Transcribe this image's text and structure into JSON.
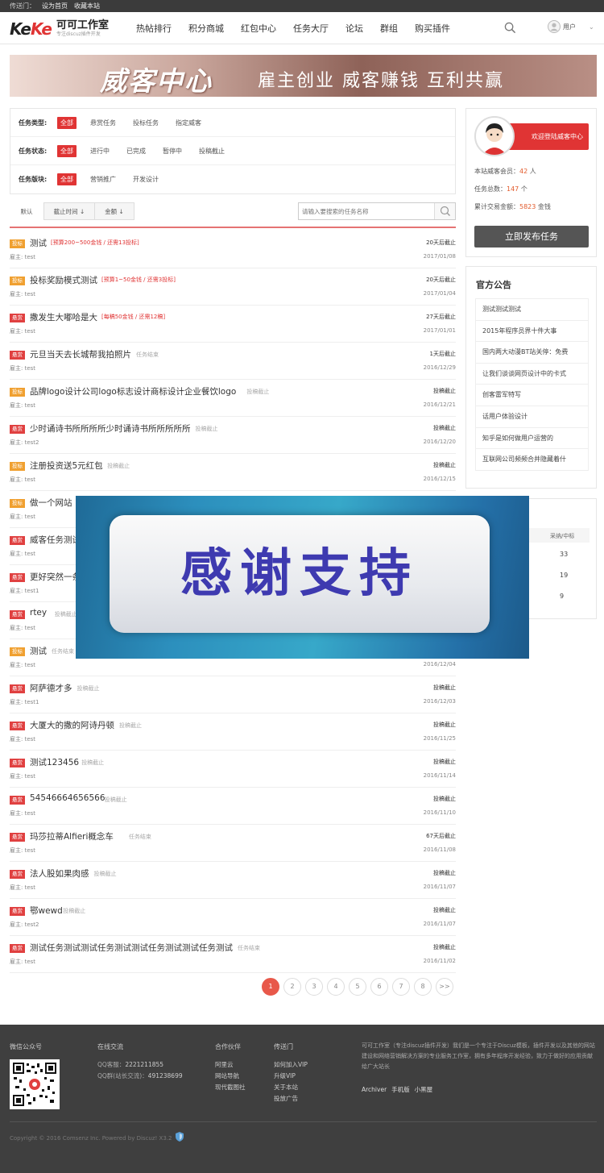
{
  "topbar": {
    "label": "传送门：",
    "set_home": "设为首页",
    "bookmark": "收藏本站"
  },
  "logo": {
    "k1": "Ke",
    "k2": "Ke",
    "name": "可可工作室",
    "slogan": "专注discuz插件开发"
  },
  "nav": [
    "热帖排行",
    "积分商城",
    "红包中心",
    "任务大厅",
    "论坛",
    "群组",
    "购买插件"
  ],
  "user": {
    "name": "用户"
  },
  "banner": {
    "title": "威客中心",
    "slogan": "雇主创业 威客赚钱 互利共赢"
  },
  "filters": [
    {
      "label": "任务类型:",
      "options": [
        "全部",
        "悬赏任务",
        "投标任务",
        "指定威客"
      ]
    },
    {
      "label": "任务状态:",
      "options": [
        "全部",
        "进行中",
        "已完成",
        "暂停中",
        "投稿截止"
      ]
    },
    {
      "label": "任务版块:",
      "options": [
        "全部",
        "营销推广",
        "开发设计"
      ]
    }
  ],
  "sort": {
    "default": "默认",
    "deadline": "截止时间",
    "amount": "金额",
    "search_placeholder": "请输入要搜索的任务名称"
  },
  "tasks": [
    {
      "tag": "投标",
      "type": "tb",
      "title": "测试",
      "budget": "[预算200~500金钱 / 还需13投标]",
      "status": "",
      "employer": "雇主: test",
      "deadline": "20天后截止",
      "date": "2017/01/08"
    },
    {
      "tag": "投标",
      "type": "tb",
      "title": "投标奖励模式测试",
      "budget": "[预算1~50金钱 / 还需3投标]",
      "status": "",
      "employer": "雇主: test",
      "deadline": "20天后截止",
      "date": "2017/01/04"
    },
    {
      "tag": "悬赏",
      "type": "xs",
      "title": "撒发生大嘟哈是大",
      "budget": "[每稿50金钱 / 还需12稿]",
      "status": "",
      "employer": "雇主: test",
      "deadline": "27天后截止",
      "date": "2017/01/01"
    },
    {
      "tag": "悬赏",
      "type": "xs",
      "title": "元旦当天去长城帮我拍照片",
      "budget": "",
      "status": "任务结束",
      "employer": "雇主: test",
      "deadline": "1天后截止",
      "date": "2016/12/29"
    },
    {
      "tag": "投标",
      "type": "tb",
      "title": "品牌logo设计公司logo标志设计商标设计企业餐饮logo",
      "budget": "",
      "status": "投稿截止",
      "employer": "雇主: test",
      "deadline": "投稿截止",
      "date": "2016/12/21"
    },
    {
      "tag": "悬赏",
      "type": "xs",
      "title": "少时诵诗书所所所所少时诵诗书所所所所所",
      "budget": "",
      "status": "投稿截止",
      "employer": "雇主: test2",
      "deadline": "投稿截止",
      "date": "2016/12/20"
    },
    {
      "tag": "投标",
      "type": "tb",
      "title": "注册投资送5元红包",
      "budget": "",
      "status": "投稿截止",
      "employer": "雇主: test",
      "deadline": "投稿截止",
      "date": "2016/12/15"
    },
    {
      "tag": "投标",
      "type": "tb",
      "title": "做一个网站",
      "budget": "",
      "status": "",
      "employer": "雇主: test",
      "deadline": "",
      "date": ""
    },
    {
      "tag": "悬赏",
      "type": "xs",
      "title": "威客任务测试",
      "budget": "",
      "status": "",
      "employer": "雇主: test",
      "deadline": "",
      "date": ""
    },
    {
      "tag": "悬赏",
      "type": "xs",
      "title": "更好突然一条",
      "budget": "",
      "status": "",
      "employer": "雇主: test1",
      "deadline": "",
      "date": ""
    },
    {
      "tag": "悬赏",
      "type": "xs",
      "title": "rtey",
      "budget": "",
      "status": "投稿截止",
      "employer": "雇主: test",
      "deadline": "",
      "date": ""
    },
    {
      "tag": "投标",
      "type": "tb",
      "title": "测试",
      "budget": "",
      "status": "任务结束",
      "employer": "雇主: test",
      "deadline": "",
      "date": "2016/12/04"
    },
    {
      "tag": "悬赏",
      "type": "xs",
      "title": "阿萨德才多",
      "budget": "",
      "status": "投稿截止",
      "employer": "雇主: test1",
      "deadline": "投稿截止",
      "date": "2016/12/03"
    },
    {
      "tag": "悬赏",
      "type": "xs",
      "title": "大厦大的撒的阿诗丹顿",
      "budget": "",
      "status": "投稿截止",
      "employer": "雇主: test",
      "deadline": "投稿截止",
      "date": "2016/11/25"
    },
    {
      "tag": "悬赏",
      "type": "xs",
      "title": "测试123456",
      "budget": "",
      "status": "投稿截止",
      "employer": "雇主: test",
      "deadline": "投稿截止",
      "date": "2016/11/14"
    },
    {
      "tag": "悬赏",
      "type": "xs",
      "title": "54546664656566",
      "budget": "",
      "status": "投稿截止",
      "employer": "雇主: test",
      "deadline": "投稿截止",
      "date": "2016/11/10"
    },
    {
      "tag": "悬赏",
      "type": "xs",
      "title": "玛莎拉蒂Alfieri概念车",
      "budget": "",
      "status": "任务结束",
      "employer": "雇主: test",
      "deadline": "67天后截止",
      "date": "2016/11/08"
    },
    {
      "tag": "悬赏",
      "type": "xs",
      "title": "法人股如果肉感",
      "budget": "",
      "status": "投稿截止",
      "employer": "雇主: test",
      "deadline": "投稿截止",
      "date": "2016/11/07"
    },
    {
      "tag": "悬赏",
      "type": "xs",
      "title": "鄂wewd",
      "budget": "",
      "status": "投稿截止",
      "employer": "雇主: test2",
      "deadline": "投稿截止",
      "date": "2016/11/07"
    },
    {
      "tag": "悬赏",
      "type": "xs",
      "title": "测试任务测试测试任务测试测试任务测试测试任务测试",
      "budget": "",
      "status": "任务结束",
      "employer": "雇主: test",
      "deadline": "投稿截止",
      "date": "2016/11/02"
    }
  ],
  "pagination": [
    "1",
    "2",
    "3",
    "4",
    "5",
    "6",
    "7",
    "8",
    ">>"
  ],
  "profile": {
    "welcome": "欢迎登陆威客中心",
    "members_label": "本站威客会员：",
    "members": "42",
    "members_unit": "人",
    "tasks_label": "任务总数：",
    "tasks": "147",
    "tasks_unit": "个",
    "amount_label": "累计交易金额：",
    "amount": "5823",
    "amount_unit": "金钱",
    "publish": "立即发布任务"
  },
  "announcements": {
    "title": "官方公告",
    "items": [
      "测试测试测试",
      "2015年程序员界十件大事",
      "国内两大动漫BT站关停：免费",
      "让我们谈谈网页设计中的卡式",
      "创客雷军特写",
      "话用户体验设计",
      "知乎是如何做用户运营的",
      "互联网公司频频合并隐藏着什"
    ]
  },
  "ranking": {
    "header": "采纳/中标",
    "values": [
      "33",
      "19",
      "9"
    ]
  },
  "overlay": {
    "text": "感谢支持"
  },
  "footer": {
    "wechat": "微信公众号",
    "online": "在线交流",
    "qq_label": "QQ客服：",
    "qq": "2221211855",
    "qqgroup_label": "QQ群(站长交流)：",
    "qqgroup": "491238699",
    "partners": "合作伙伴",
    "partner_links": [
      "阿里云",
      "网站导航",
      "现代截图社"
    ],
    "portal": "传送门",
    "portal_links": [
      "如何加入VIP",
      "升级VIP",
      "关于本站",
      "投放广告"
    ],
    "about": "可可工作室（专注discuz插件开发）我们是一个专注于Discuz模板，插件开发以及其他的网站建设和网络营销解决方案的专业服务工作室，拥有多年程序开发经验，致力于做好的应用贡献给广大站长",
    "links": [
      "Archiver",
      "手机版",
      "小黑屋"
    ],
    "copyright": "Copyright © 2016 Comsenz Inc. Powered by Discuz! X3.2"
  }
}
